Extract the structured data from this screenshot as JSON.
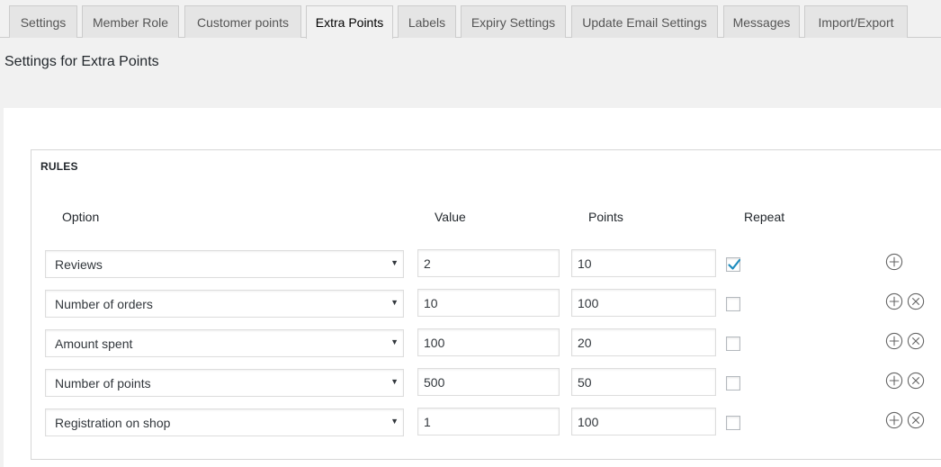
{
  "tabs": [
    {
      "label": "Settings",
      "active": false
    },
    {
      "label": "Member Role",
      "active": false
    },
    {
      "label": "Customer points",
      "active": false
    },
    {
      "label": "Extra Points",
      "active": true
    },
    {
      "label": "Labels",
      "active": false
    },
    {
      "label": "Expiry Settings",
      "active": false
    },
    {
      "label": "Update Email Settings",
      "active": false
    },
    {
      "label": "Messages",
      "active": false
    },
    {
      "label": "Import/Export",
      "active": false
    }
  ],
  "page": {
    "title": "Settings for Extra Points"
  },
  "rules": {
    "title": "RULES",
    "headers": {
      "option": "Option",
      "value": "Value",
      "points": "Points",
      "repeat": "Repeat"
    },
    "rows": [
      {
        "option": "Reviews",
        "value": "2",
        "points": "10",
        "repeat": true,
        "can_remove": false
      },
      {
        "option": "Number of orders",
        "value": "10",
        "points": "100",
        "repeat": false,
        "can_remove": true
      },
      {
        "option": "Amount spent",
        "value": "100",
        "points": "20",
        "repeat": false,
        "can_remove": true
      },
      {
        "option": "Number of points",
        "value": "500",
        "points": "50",
        "repeat": false,
        "can_remove": true
      },
      {
        "option": "Registration on shop",
        "value": "1",
        "points": "100",
        "repeat": false,
        "can_remove": true
      }
    ]
  },
  "icons": {
    "dropdown": "caret-down-icon",
    "add": "add-circle-icon",
    "remove": "remove-circle-icon",
    "check": "checkmark-icon"
  },
  "colors": {
    "check": "#1e8cbe",
    "tab_bg": "#e5e5e5",
    "page_bg": "#f1f1f1",
    "border": "#dddddd"
  }
}
